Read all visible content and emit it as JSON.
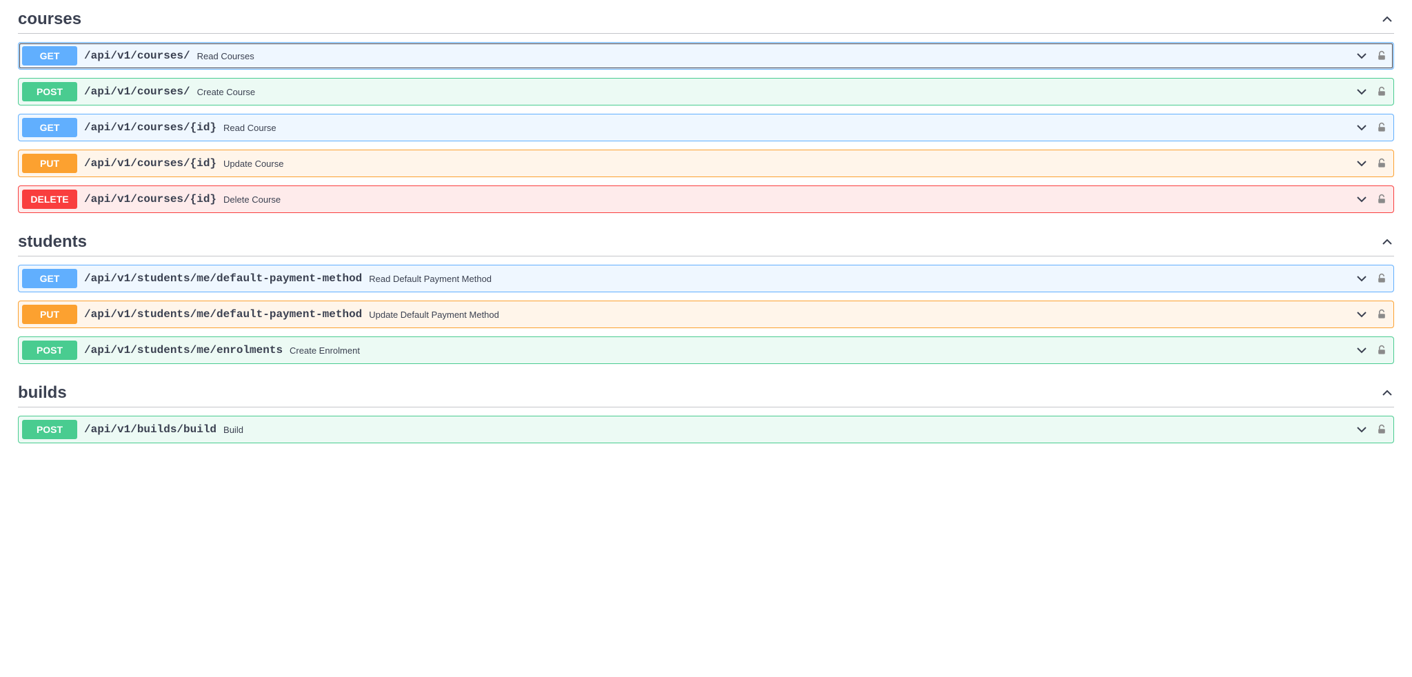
{
  "sections": [
    {
      "title": "courses",
      "endpoints": [
        {
          "method": "GET",
          "path": "/api/v1/courses/",
          "summary": "Read Courses",
          "highlight": true
        },
        {
          "method": "POST",
          "path": "/api/v1/courses/",
          "summary": "Create Course"
        },
        {
          "method": "GET",
          "path": "/api/v1/courses/{id}",
          "summary": "Read Course"
        },
        {
          "method": "PUT",
          "path": "/api/v1/courses/{id}",
          "summary": "Update Course"
        },
        {
          "method": "DELETE",
          "path": "/api/v1/courses/{id}",
          "summary": "Delete Course"
        }
      ]
    },
    {
      "title": "students",
      "endpoints": [
        {
          "method": "GET",
          "path": "/api/v1/students/me/default-payment-method",
          "summary": "Read Default Payment Method"
        },
        {
          "method": "PUT",
          "path": "/api/v1/students/me/default-payment-method",
          "summary": "Update Default Payment Method"
        },
        {
          "method": "POST",
          "path": "/api/v1/students/me/enrolments",
          "summary": "Create Enrolment"
        }
      ]
    },
    {
      "title": "builds",
      "endpoints": [
        {
          "method": "POST",
          "path": "/api/v1/builds/build",
          "summary": "Build"
        }
      ]
    }
  ]
}
